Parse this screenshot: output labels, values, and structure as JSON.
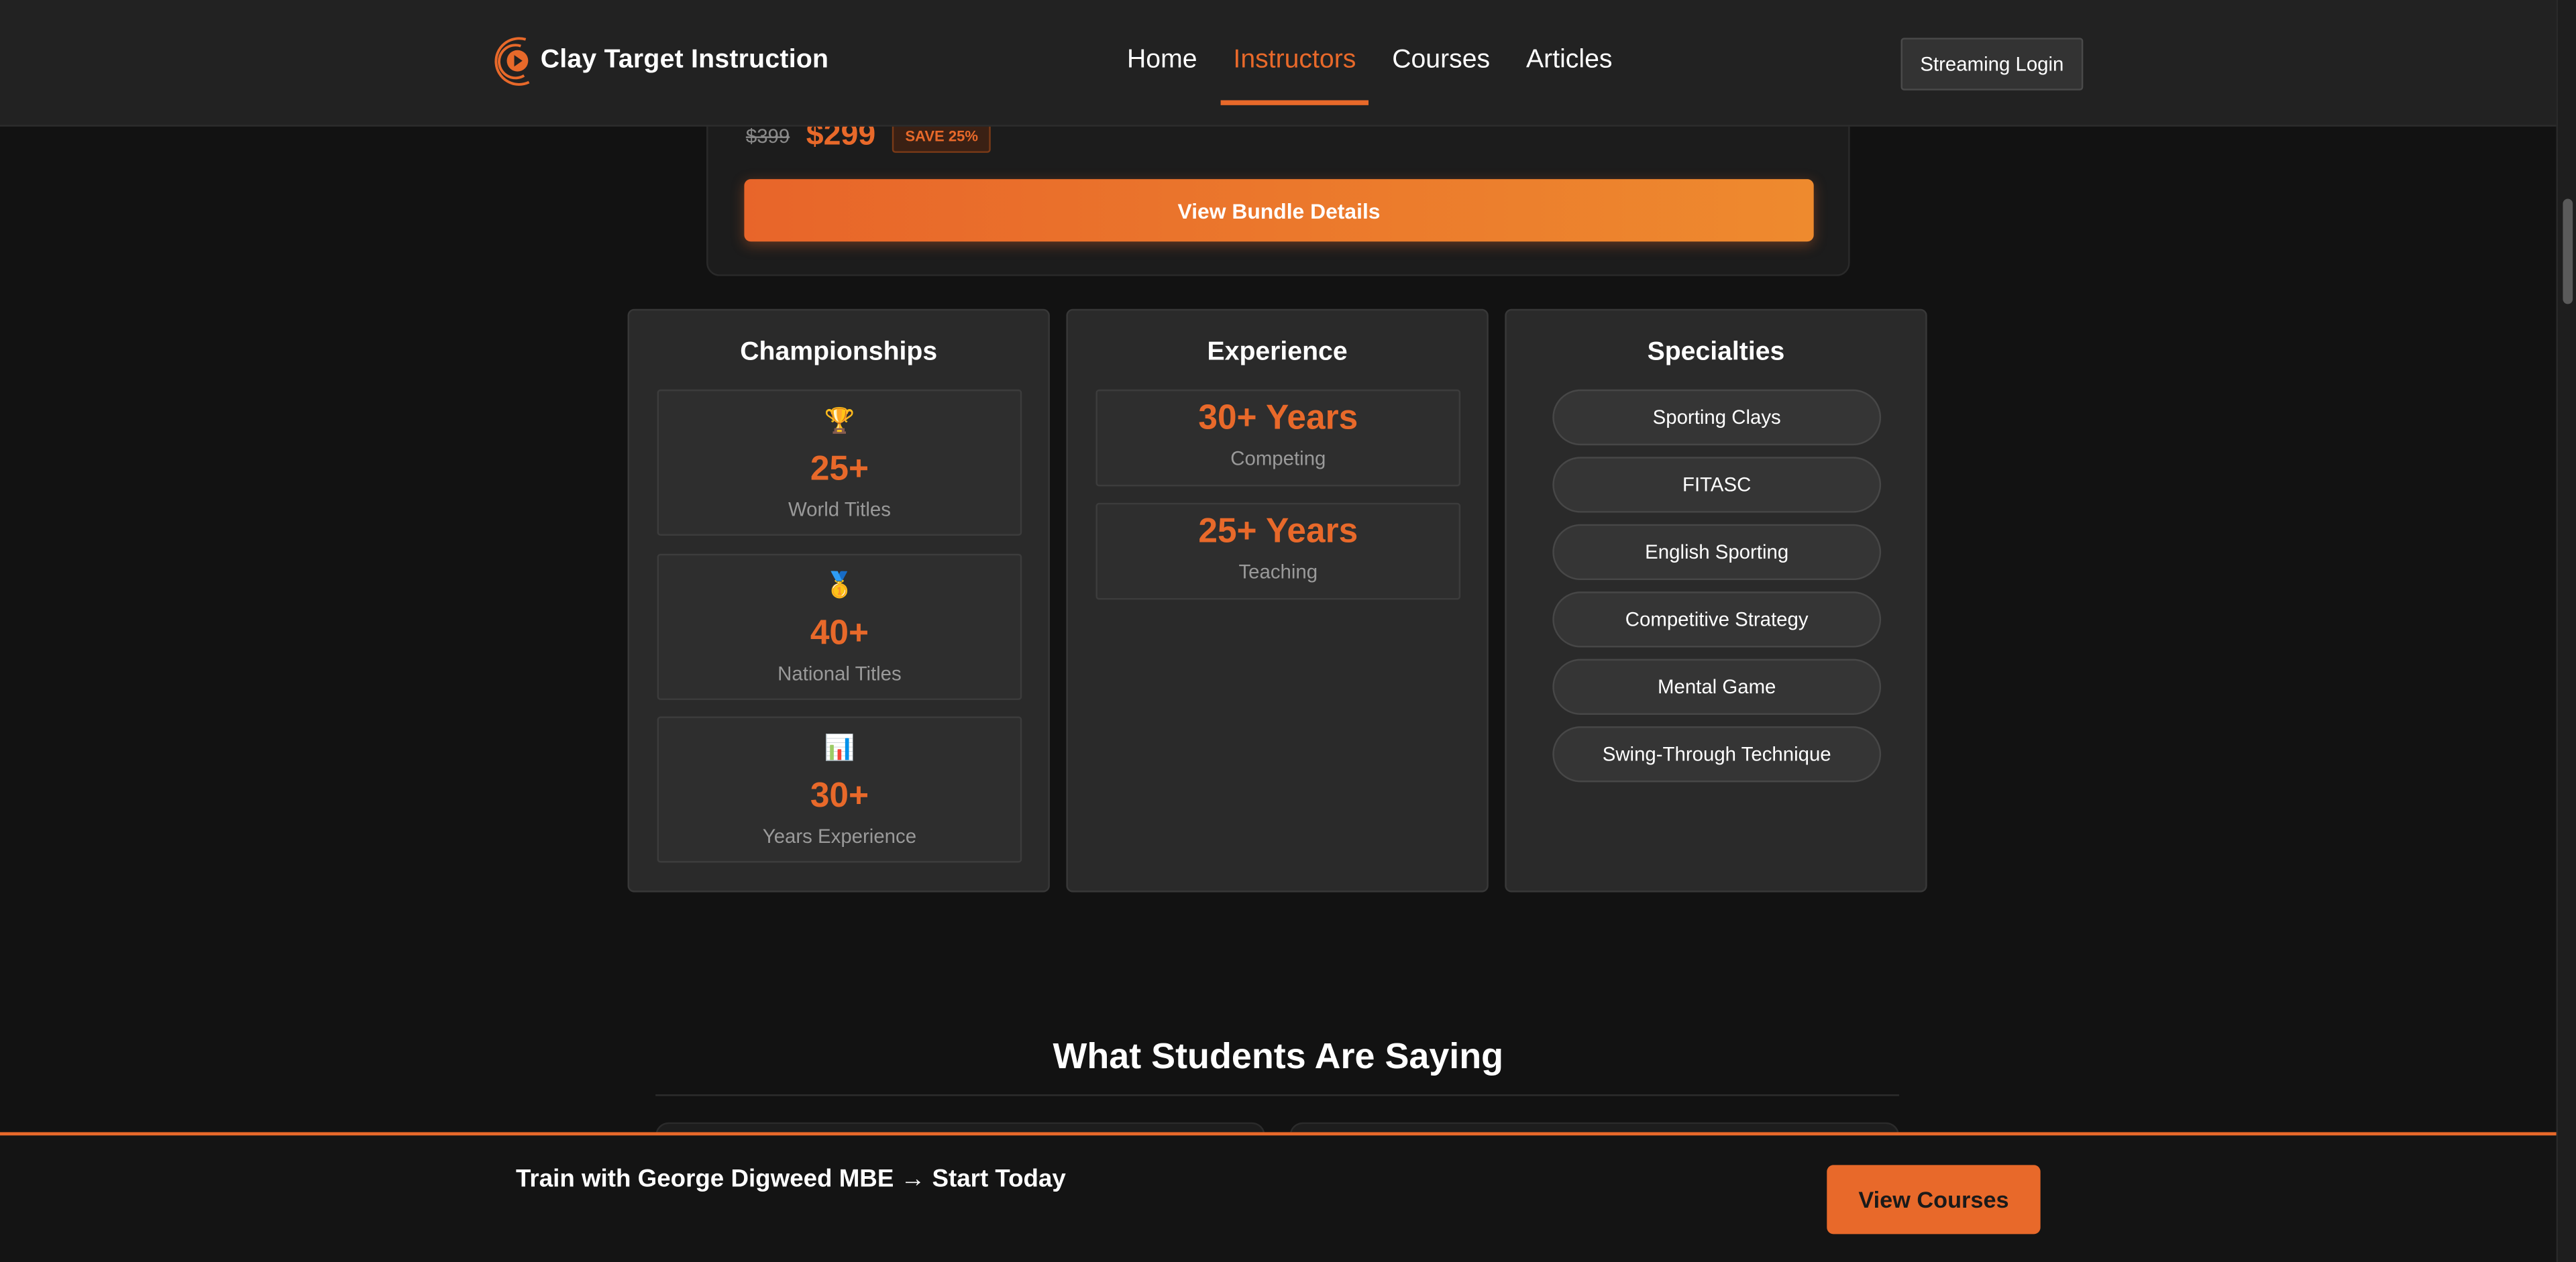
{
  "header": {
    "brand": "Clay Target Instruction",
    "nav": [
      {
        "label": "Home",
        "active": false
      },
      {
        "label": "Instructors",
        "active": true
      },
      {
        "label": "Courses",
        "active": false
      },
      {
        "label": "Articles",
        "active": false
      }
    ],
    "streaming_login": "Streaming Login"
  },
  "bundle": {
    "old_price": "$399",
    "new_price": "$299",
    "save_badge": "SAVE 25%",
    "cta": "View Bundle Details"
  },
  "championships": {
    "title": "Championships",
    "stats": [
      {
        "icon": "trophy-icon",
        "glyph": "🏆",
        "value": "25+",
        "label": "World Titles"
      },
      {
        "icon": "medal-icon",
        "glyph": "🥇",
        "value": "40+",
        "label": "National Titles"
      },
      {
        "icon": "bar-chart-icon",
        "glyph": "📊",
        "value": "30+",
        "label": "Years Experience"
      }
    ]
  },
  "experience": {
    "title": "Experience",
    "items": [
      {
        "value": "30+ Years",
        "label": "Competing"
      },
      {
        "value": "25+ Years",
        "label": "Teaching"
      }
    ]
  },
  "specialties": {
    "title": "Specialties",
    "items": [
      "Sporting Clays",
      "FITASC",
      "English Sporting",
      "Competitive Strategy",
      "Mental Game",
      "Swing-Through Technique"
    ]
  },
  "testimonials": {
    "title": "What Students Are Saying"
  },
  "cta_bar": {
    "text": "Train with George Digweed MBE → Start Today",
    "button": "View Courses"
  },
  "colors": {
    "accent": "#e8692a",
    "background": "#121212",
    "panel": "#2a2a2a"
  }
}
